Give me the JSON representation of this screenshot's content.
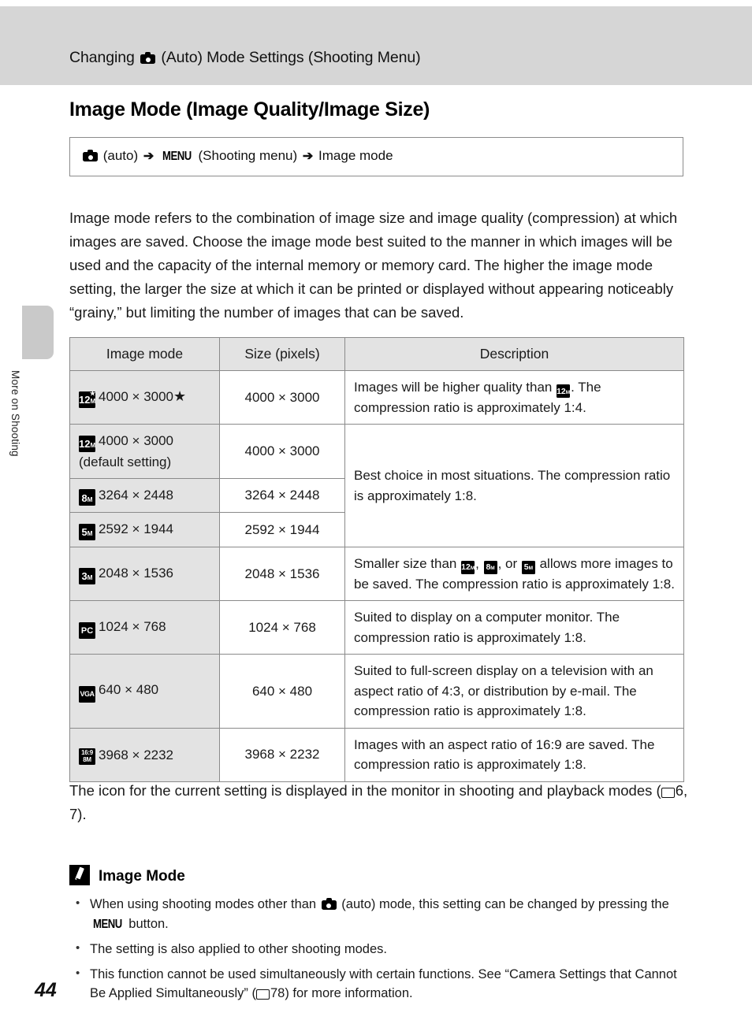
{
  "header": {
    "prefix": "Changing",
    "camera_icon": "camera-icon",
    "suffix": "(Auto) Mode Settings (Shooting Menu)"
  },
  "side_tab": {
    "label": "More on Shooting"
  },
  "page": {
    "title": "Image Mode (Image Quality/Image Size)",
    "number": "44"
  },
  "nav_path": {
    "camera_icon": "camera-icon",
    "auto_label": "(auto)",
    "arrow": "➔",
    "menu_label": "MENU",
    "shooting_menu": "(Shooting menu)",
    "arrow2": "➔",
    "destination": "Image mode"
  },
  "intro": "Image mode refers to the combination of image size and image quality (compression) at which images are saved. Choose the image mode best suited to the manner in which images will be used and the capacity of the internal memory or memory card. The higher the image mode setting, the larger the size at which it can be printed or displayed without appearing noticeably “grainy,” but limiting the number of images that can be saved.",
  "table": {
    "columns": [
      "Image mode",
      "Size (pixels)",
      "Description"
    ],
    "rows": [
      {
        "badge": "12",
        "badge_sub": "M",
        "badge_star": true,
        "mode": "4000 × 3000",
        "mode_star": "★",
        "size": "4000 × 3000",
        "desc_pre": "Images will be higher quality than ",
        "desc_badge": "12",
        "desc_badge_sub": "M",
        "desc_post": ". The compression ratio is approximately 1:4."
      },
      {
        "badge": "12",
        "badge_sub": "M",
        "mode": "4000 × 3000",
        "mode_line2": "(default setting)",
        "size": "4000 × 3000",
        "desc_group": "Best choice in most situations. The compression ratio is approximately 1:8."
      },
      {
        "badge": "8",
        "badge_sub": "M",
        "mode": "3264 × 2448",
        "size": "3264 × 2448"
      },
      {
        "badge": "5",
        "badge_sub": "M",
        "mode": "2592 × 1944",
        "size": "2592 × 1944"
      },
      {
        "badge": "3",
        "badge_sub": "M",
        "mode": "2048 × 1536",
        "size": "2048 × 1536",
        "desc_pre": "Smaller size than ",
        "desc_badges": [
          "12",
          "8",
          "5"
        ],
        "desc_post": " allows more images to be saved. The compression ratio is approximately 1:8.",
        "desc_sep1": ", ",
        "desc_sep2": ", or "
      },
      {
        "badge": "PC",
        "mode": "1024 × 768",
        "size": "1024 × 768",
        "desc": "Suited to display on a computer monitor. The compression ratio is approximately 1:8."
      },
      {
        "badge": "VGA",
        "mode": "640 × 480",
        "size": "640 × 480",
        "desc": "Suited to full-screen display on a television with an aspect ratio of 4:3, or distribution by e-mail. The compression ratio is approximately 1:8."
      },
      {
        "badge_line1": "16:9",
        "badge_line2": "8M",
        "mode": "3968 × 2232",
        "size": "3968 × 2232",
        "desc": "Images with an aspect ratio of 16:9 are saved. The compression ratio is approximately 1:8."
      }
    ]
  },
  "after_table": {
    "text_pre": "The icon for the current setting is displayed in the monitor in shooting and playback modes (",
    "book_icon": "book-reference-icon",
    "ref": "6, 7",
    "text_post": ")."
  },
  "note": {
    "icon": "pencil-icon",
    "heading": "Image Mode",
    "bullets": [
      {
        "pre": "When using shooting modes other than ",
        "camera_icon": "camera-icon",
        "mid": " (auto) mode, this setting can be changed by pressing the ",
        "menu": "MENU",
        "post": " button."
      },
      {
        "plain": "The setting is also applied to other shooting modes."
      },
      {
        "pre": "This function cannot be used simultaneously with certain functions. See “Camera Settings that Cannot Be Applied Simultaneously” (",
        "book_icon": "book-reference-icon",
        "ref": "78",
        "post": ") for more information."
      }
    ]
  },
  "colors": {
    "header_band": "#d6d6d6",
    "table_shade": "#e3e3e3",
    "table_border": "#8a8a8a",
    "side_tab": "#c9c9c9"
  }
}
